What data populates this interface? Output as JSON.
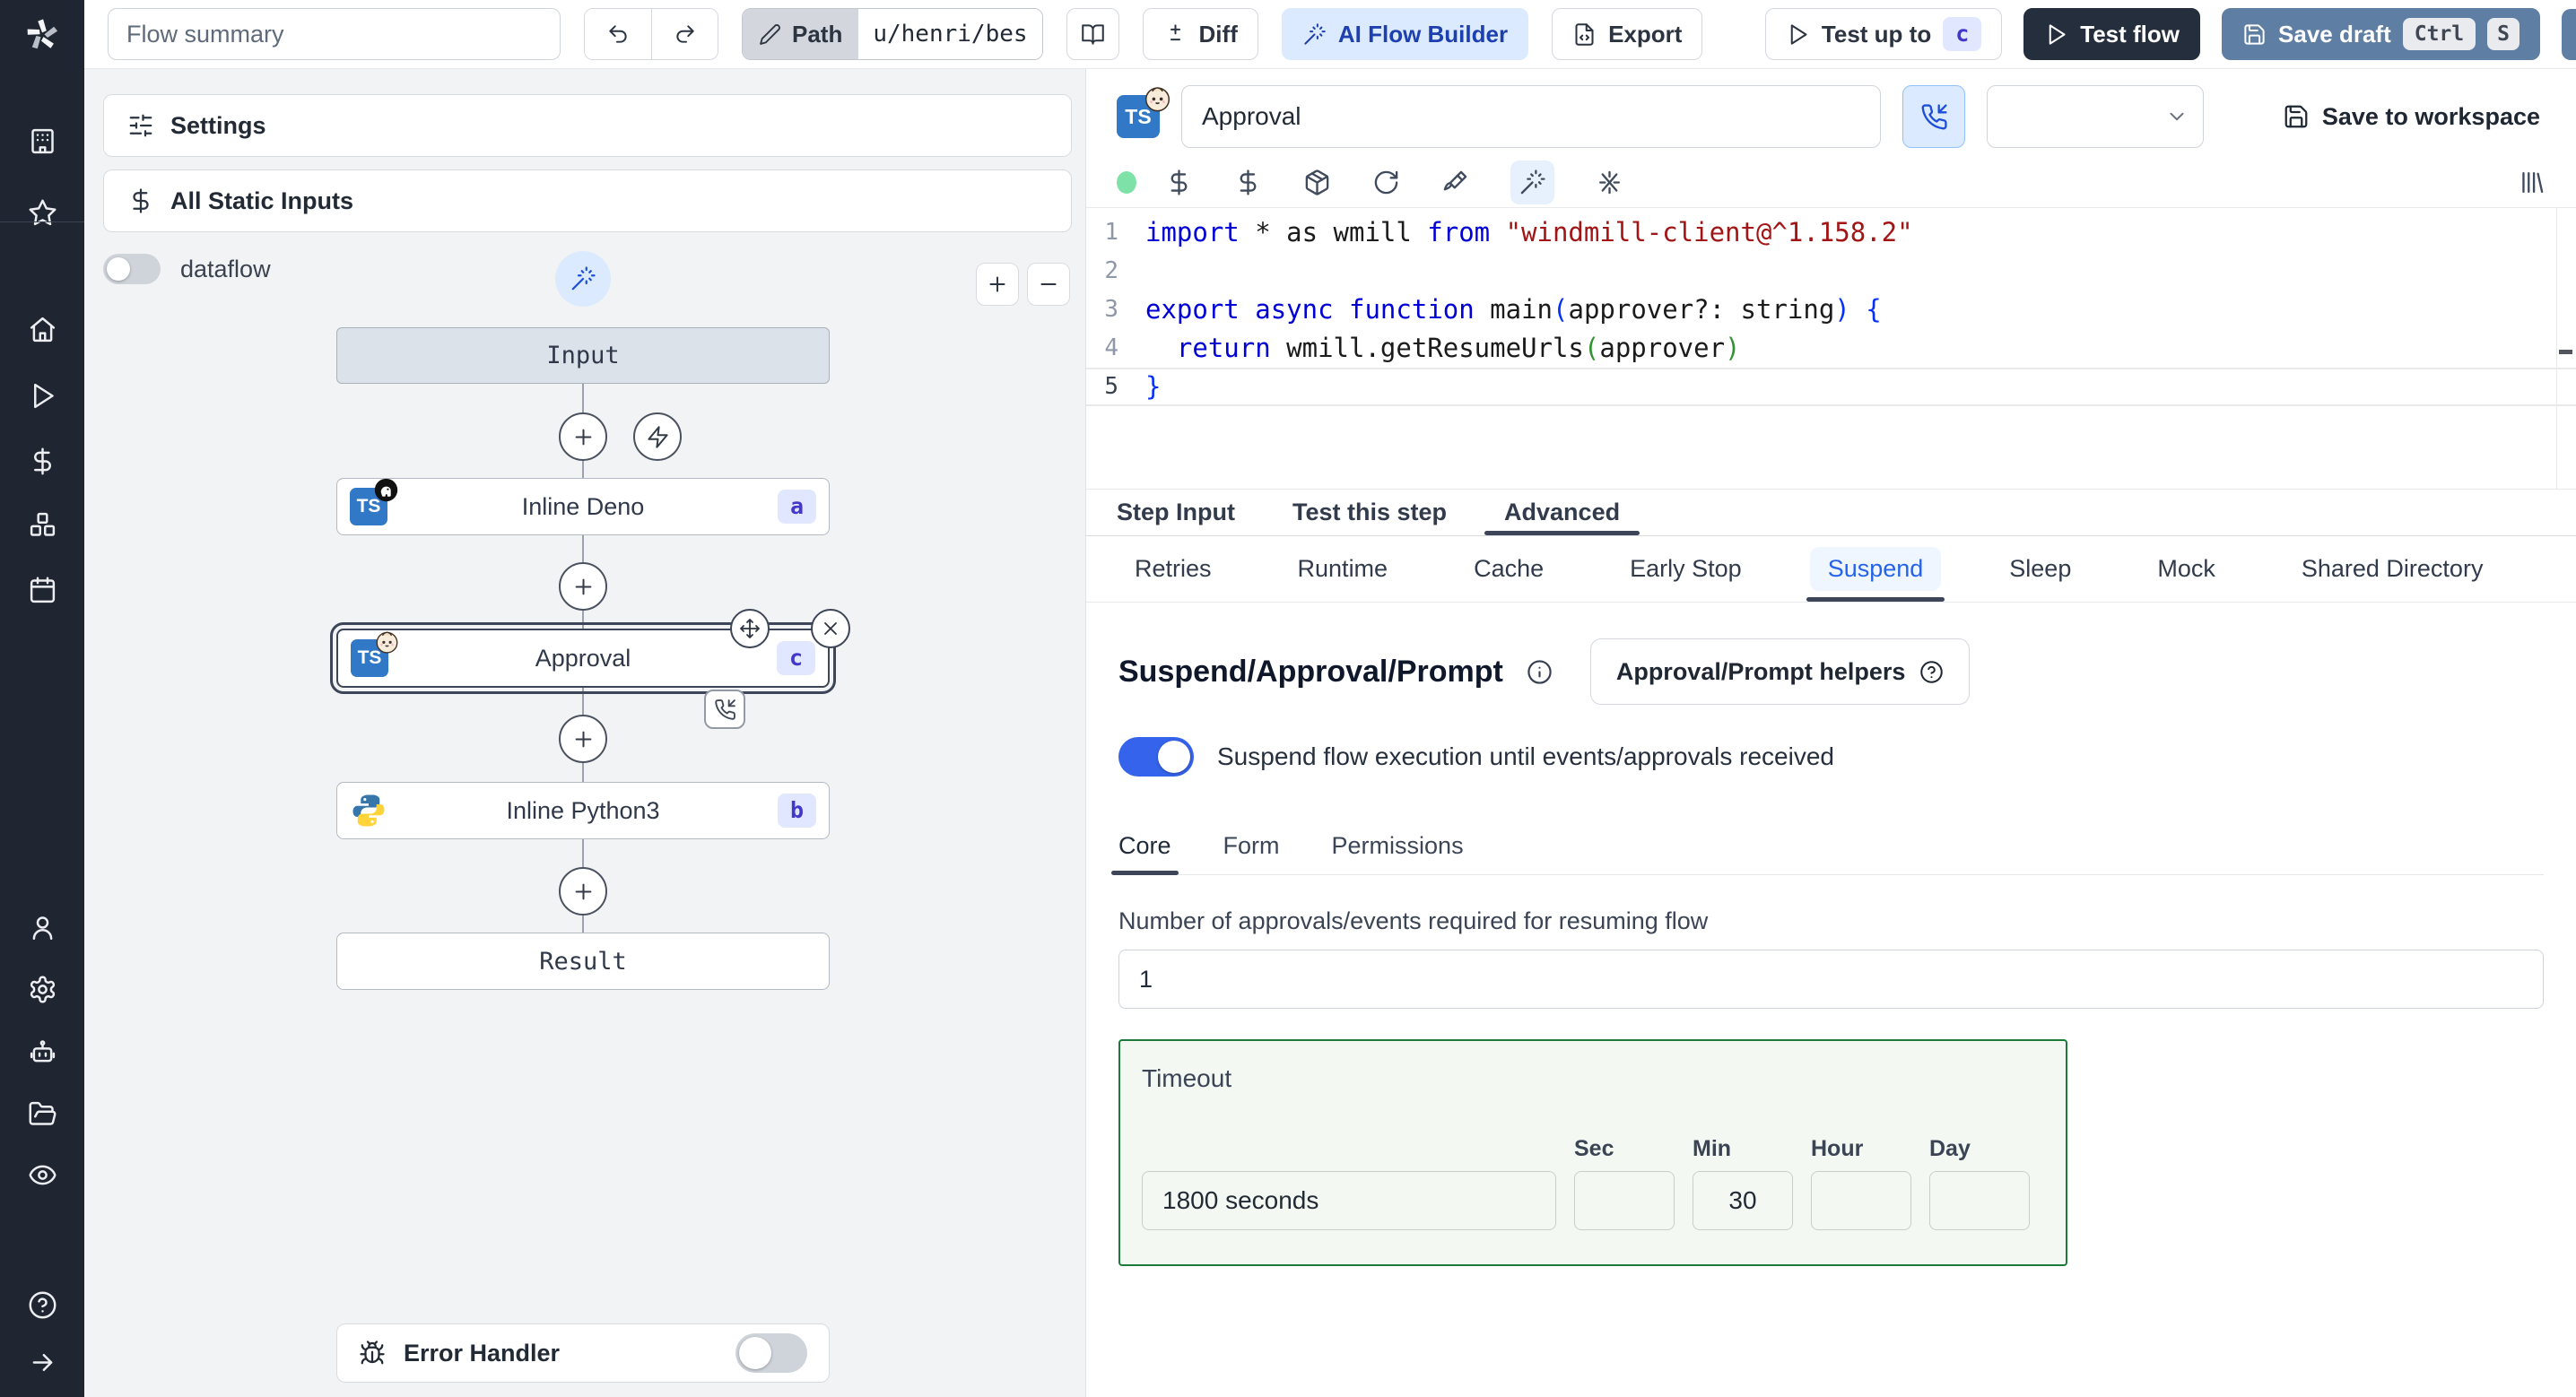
{
  "topbar": {
    "summary_placeholder": "Flow summary",
    "path_label": "Path",
    "path_value": "u/henri/bes",
    "diff_label": "Diff",
    "ai_flow_builder_label": "AI Flow Builder",
    "export_label": "Export",
    "test_up_to_label": "Test up to",
    "test_up_to_badge": "c",
    "test_flow_label": "Test flow",
    "save_draft_label": "Save draft",
    "save_draft_kbd": [
      "Ctrl",
      "S"
    ]
  },
  "sidebar": {
    "icon_names": [
      "windmill-logo",
      "building",
      "star",
      "home",
      "play",
      "dollar",
      "boxes",
      "calendar",
      "user",
      "settings-gear",
      "robot",
      "folder-open",
      "eye",
      "help-circle",
      "arrow-right"
    ]
  },
  "flow_panel": {
    "settings_label": "Settings",
    "static_inputs_label": "All Static Inputs",
    "dataflow_label": "dataflow",
    "dataflow_on": false,
    "nodes": {
      "input": {
        "label": "Input"
      },
      "deno": {
        "label": "Inline Deno",
        "badge": "a"
      },
      "approval": {
        "label": "Approval",
        "badge": "c",
        "selected": true
      },
      "python": {
        "label": "Inline Python3",
        "badge": "b"
      },
      "result": {
        "label": "Result"
      }
    },
    "error_handler_label": "Error Handler",
    "error_handler_on": false
  },
  "step_editor": {
    "ts_logo_text": "TS",
    "name_value": "Approval",
    "save_to_workspace_label": "Save to workspace",
    "toolbar_icon_names": [
      "status-dot",
      "dollar",
      "dollar",
      "package",
      "rotate-cw",
      "paintbrush",
      "wand-sparkles",
      "sparkles-fix",
      "library"
    ],
    "code": {
      "current_line": 5,
      "lines": [
        {
          "n": 1,
          "tokens": [
            [
              "k",
              "import"
            ],
            [
              "p",
              " * as wmill "
            ],
            [
              "k",
              "from"
            ],
            [
              "p",
              " "
            ],
            [
              "s",
              "\"windmill-client@^1.158.2\""
            ]
          ]
        },
        {
          "n": 2,
          "tokens": []
        },
        {
          "n": 3,
          "tokens": [
            [
              "k",
              "export"
            ],
            [
              "p",
              " "
            ],
            [
              "k",
              "async"
            ],
            [
              "p",
              " "
            ],
            [
              "k",
              "function"
            ],
            [
              "p",
              " main"
            ],
            [
              "b1",
              "("
            ],
            [
              "p",
              "approver?: string"
            ],
            [
              "b1",
              ")"
            ],
            [
              "p",
              " "
            ],
            [
              "b1",
              "{"
            ]
          ]
        },
        {
          "n": 4,
          "tokens": [
            [
              "p",
              "  "
            ],
            [
              "k",
              "return"
            ],
            [
              "p",
              " wmill.getResumeUrls"
            ],
            [
              "b2",
              "("
            ],
            [
              "p",
              "approver"
            ],
            [
              "b2",
              ")"
            ]
          ]
        },
        {
          "n": 5,
          "tokens": [
            [
              "b1",
              "}"
            ]
          ]
        }
      ]
    },
    "tabs": [
      "Step Input",
      "Test this step",
      "Advanced"
    ],
    "active_tab": "Advanced",
    "advanced_tabs": [
      "Retries",
      "Runtime",
      "Cache",
      "Early Stop",
      "Suspend",
      "Sleep",
      "Mock",
      "Shared Directory"
    ],
    "active_advanced_tab": "Suspend"
  },
  "suspend_section": {
    "title": "Suspend/Approval/Prompt",
    "helpers_button_label": "Approval/Prompt helpers",
    "toggle_label": "Suspend flow execution until events/approvals received",
    "toggle_on": true,
    "tabs": [
      "Core",
      "Form",
      "Permissions"
    ],
    "active_tab": "Core",
    "approvals_label": "Number of approvals/events required for resuming flow",
    "approvals_value": "1",
    "timeout_label": "Timeout",
    "timeout_value": "1800 seconds",
    "timeout_units": [
      {
        "label": "Sec",
        "value": ""
      },
      {
        "label": "Min",
        "value": "30"
      },
      {
        "label": "Hour",
        "value": ""
      },
      {
        "label": "Day",
        "value": ""
      }
    ]
  },
  "colors": {
    "sidebar_bg": "#1f2531",
    "accent_light_blue": "#dbeafe",
    "accent_blue_text": "#1e40af",
    "save_draft_bg": "#5f7ea4",
    "test_flow_bg": "#252e3d",
    "toggle_on": "#3563eb",
    "timeout_border": "#1d7a39",
    "badge_bg": "#e0e7ff",
    "badge_text": "#4338ca",
    "status_dot": "#7ee2a8"
  }
}
